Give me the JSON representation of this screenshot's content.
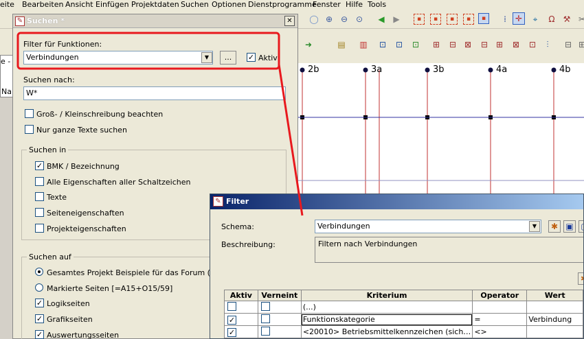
{
  "menu": [
    "eite",
    "Bearbeiten",
    "Ansicht",
    "Einfügen",
    "Projektdaten",
    "Suchen",
    "Optionen",
    "Dienstprogramme",
    "Fenster",
    "Hilfe",
    "Tools"
  ],
  "left_stub": {
    "text1": "e -",
    "text2": "Nar"
  },
  "canvas": {
    "columns": [
      "2b",
      "3a",
      "3b",
      "4a",
      "4b"
    ]
  },
  "search_dialog": {
    "title": "Suchen *",
    "close": "✕",
    "filter_label": "Filter für Funktionen:",
    "filter_value": "Verbindungen",
    "browse_label": "...",
    "aktiv_label": "Aktiv",
    "aktiv_checked": true,
    "search_for_label": "Suchen nach:",
    "search_value": "W*",
    "option_case": "Groß- / Kleinschreibung beachten",
    "option_whole": "Nur ganze Texte suchen",
    "search_in_title": "Suchen in",
    "search_in": [
      {
        "label": "BMK / Bezeichnung",
        "checked": true
      },
      {
        "label": "Alle Eigenschaften aller Schaltzeichen",
        "checked": false
      },
      {
        "label": "Texte",
        "checked": false
      },
      {
        "label": "Seiteneigenschaften",
        "checked": false
      },
      {
        "label": "Projekteigenschaften",
        "checked": false
      }
    ],
    "search_on_title": "Suchen auf",
    "search_on_radio": [
      {
        "label": "Gesamtes Projekt Beispiele für das Forum (Home)",
        "selected": true
      },
      {
        "label": "Markierte Seiten [=A15+O15/59]",
        "selected": false
      }
    ],
    "search_on_checks": [
      {
        "label": "Logikseiten",
        "checked": true
      },
      {
        "label": "Grafikseiten",
        "checked": true
      },
      {
        "label": "Auswertungsseiten",
        "checked": true
      }
    ]
  },
  "filter_dialog": {
    "title": "Filter",
    "schema_label": "Schema:",
    "schema_value": "Verbindungen",
    "description_label": "Beschreibung:",
    "description_value": "Filtern nach Verbindungen",
    "table": {
      "headers": [
        "Aktiv",
        "Verneint",
        "Kriterium",
        "Operator",
        "Wert"
      ],
      "rows": [
        {
          "aktiv": "",
          "verneint": "",
          "kriterium": "(...)",
          "operator": "",
          "wert": ""
        },
        {
          "aktiv": "✓",
          "verneint": "",
          "kriterium": "Funktionskategorie",
          "operator": "=",
          "wert": "Verbindung"
        },
        {
          "aktiv": "✓",
          "verneint": "",
          "kriterium": "<20010> Betriebsmittelkennzeichen (sich…",
          "operator": "<>",
          "wert": ""
        }
      ]
    }
  },
  "colors": {
    "highlight": "#e8191e",
    "title_active": "#0a246a",
    "canvas_line": "#c03030",
    "canvas_hline": "#3030a0"
  }
}
